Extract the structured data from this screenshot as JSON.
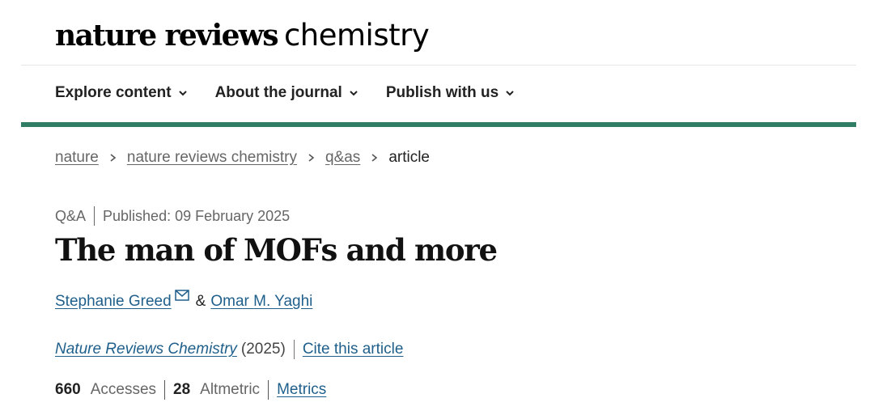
{
  "header": {
    "logo_bold": "nature reviews",
    "logo_light": "chemistry"
  },
  "nav": {
    "items": [
      {
        "label": "Explore content"
      },
      {
        "label": "About the journal"
      },
      {
        "label": "Publish with us"
      }
    ],
    "accent_color": "#2e7d64"
  },
  "breadcrumb": {
    "items": [
      {
        "label": "nature"
      },
      {
        "label": "nature reviews chemistry"
      },
      {
        "label": "q&as"
      }
    ],
    "current": "article"
  },
  "article": {
    "type": "Q&A",
    "published": "Published: 09 February 2025",
    "title": "The man of MOFs and more",
    "authors": [
      {
        "name": "Stephanie Greed"
      },
      {
        "name": "Omar M. Yaghi"
      }
    ],
    "author_separator": "&",
    "journal_name": "Nature Reviews Chemistry",
    "journal_year": "(2025)",
    "cite_label": "Cite this article",
    "stats": {
      "accesses_value": "660",
      "accesses_label": "Accesses",
      "altmetric_value": "28",
      "altmetric_label": "Altmetric",
      "metrics_label": "Metrics"
    },
    "link_color": "#1f5f8b"
  }
}
